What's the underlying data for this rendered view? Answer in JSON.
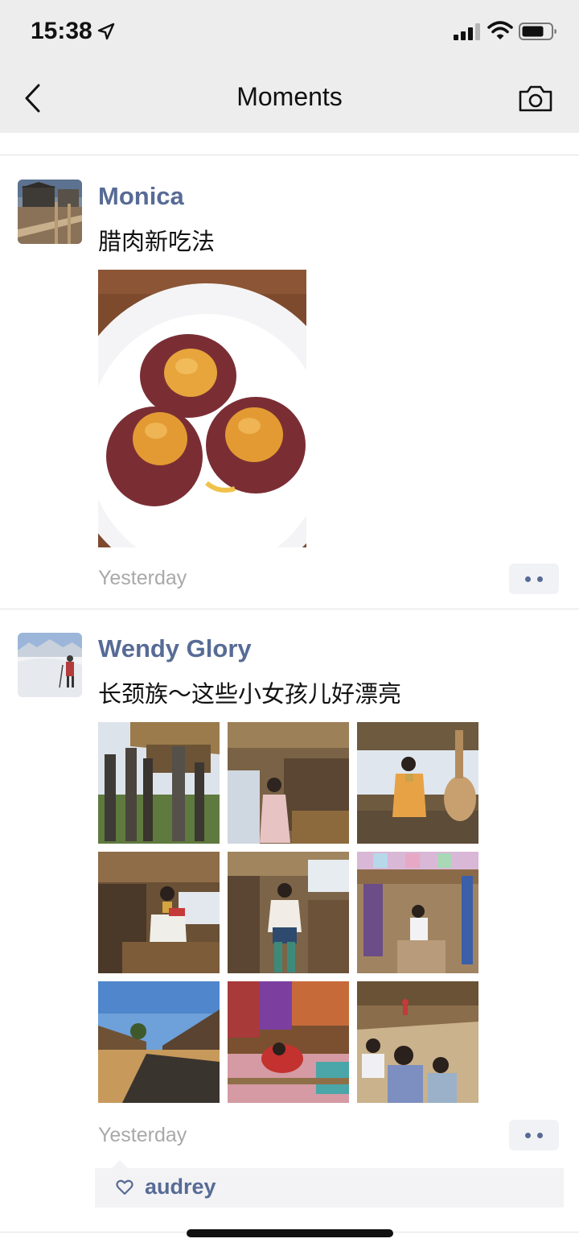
{
  "status_bar": {
    "time": "15:38"
  },
  "nav": {
    "title": "Moments"
  },
  "posts": [
    {
      "author": "Monica",
      "text": "腊肉新吃法",
      "timestamp": "Yesterday",
      "photos": [
        "meat-patties-with-egg-yolks"
      ]
    },
    {
      "author": "Wendy Glory",
      "text": "长颈族～这些小女孩儿好漂亮",
      "timestamp": "Yesterday",
      "photos": [
        "wooden-sculptures",
        "girl-in-market-stall",
        "girl-with-guitar",
        "woman-with-neck-rings",
        "girl-in-doorway",
        "market-stall-textiles",
        "thatched-huts-path",
        "woman-weaving-textiles",
        "village-children"
      ],
      "likes": [
        "audrey"
      ]
    }
  ],
  "colors": {
    "link": "#576b95",
    "header_bg": "#ededed",
    "timestamp": "#a9a9a9",
    "likes_bg": "#f3f3f5"
  }
}
